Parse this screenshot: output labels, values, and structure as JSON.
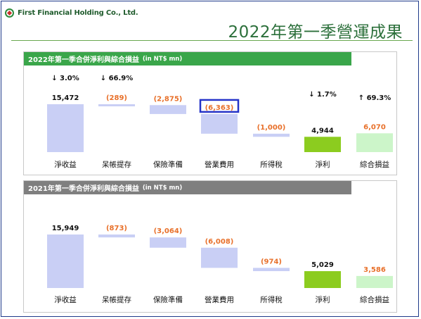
{
  "header": {
    "company": "First Financial Holding Co., Ltd.",
    "title": "2022年第一季營運成果"
  },
  "colors": {
    "brand_green": "#2b6f3a",
    "header_2022": "#3aa64a",
    "header_2021": "#7f7f7f",
    "bar_blue": "#c9cff5",
    "bar_net": "#8ccc1f",
    "bar_comprehensive": "#ccf5c9",
    "value_negative": "#e8702a",
    "highlight_box": "#2533c8"
  },
  "chart_data": [
    {
      "type": "waterfall",
      "title": "2022年第一季合併淨利與綜合損益",
      "unit": "(in NT$ mn)",
      "categories": [
        "淨收益",
        "呆帳提存",
        "保險準備",
        "營業費用",
        "所得稅",
        "淨利",
        "綜合損益"
      ],
      "values": [
        15472,
        -289,
        -2875,
        -6363,
        -1000,
        4944,
        6070
      ],
      "value_labels": [
        "15,472",
        "(289)",
        "(2,875)",
        "(6,363)",
        "(1,000)",
        "4,944",
        "6,070"
      ],
      "changes": [
        {
          "category": "淨收益",
          "label": "↓ 3.0%"
        },
        {
          "category": "呆帳提存",
          "label": "↓ 66.9%"
        },
        {
          "category": "淨利",
          "label": "↓ 1.7%"
        },
        {
          "category": "綜合損益",
          "label": "↑ 69.3%"
        }
      ],
      "highlighted_category": "營業費用"
    },
    {
      "type": "waterfall",
      "title": "2021年第一季合併淨利與綜合損益",
      "unit": "(in NT$ mn)",
      "categories": [
        "淨收益",
        "呆帳提存",
        "保險準備",
        "營業費用",
        "所得稅",
        "淨利",
        "綜合損益"
      ],
      "values": [
        15949,
        -873,
        -3064,
        -6008,
        -974,
        5029,
        3586
      ],
      "value_labels": [
        "15,949",
        "(873)",
        "(3,064)",
        "(6,008)",
        "(974)",
        "5,029",
        "3,586"
      ]
    }
  ]
}
